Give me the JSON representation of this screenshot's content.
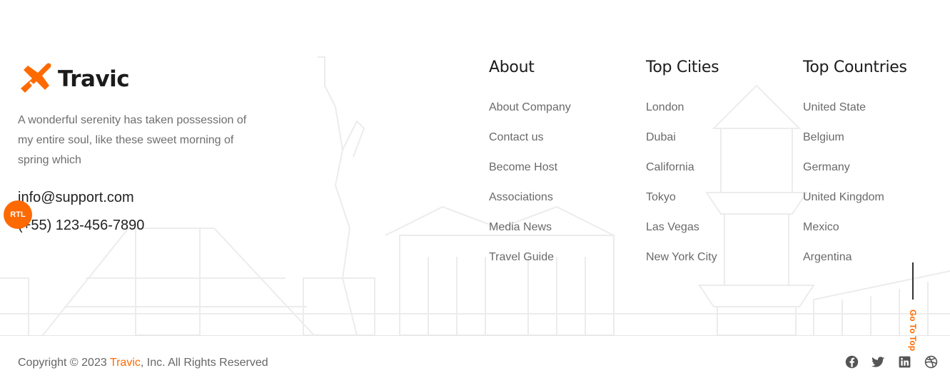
{
  "brand": {
    "name": "Travic",
    "accent_color": "#ff6a00"
  },
  "description": "A wonderful serenity has taken possession of my entire soul, like these sweet morning of spring which",
  "contact": {
    "email": "info@support.com",
    "phone": "(+55) 123-456-7890"
  },
  "rtl_badge": "RTL",
  "columns": {
    "about": {
      "title": "About",
      "items": [
        "About Company",
        "Contact us",
        "Become Host",
        "Associations",
        "Media News",
        "Travel Guide"
      ]
    },
    "cities": {
      "title": "Top Cities",
      "items": [
        "London",
        "Dubai",
        "California",
        "Tokyo",
        "Las Vegas",
        "New York City"
      ]
    },
    "countries": {
      "title": "Top Countries",
      "items": [
        "United State",
        "Belgium",
        "Germany",
        "United Kingdom",
        "Mexico",
        "Argentina"
      ]
    }
  },
  "go_top": "Go To Top",
  "copyright": {
    "prefix": "Copyright © 2023 ",
    "brand": "Travic",
    "suffix": ", Inc. All Rights Reserved"
  },
  "socials": [
    "facebook-icon",
    "twitter-icon",
    "linkedin-icon",
    "dribbble-icon"
  ]
}
